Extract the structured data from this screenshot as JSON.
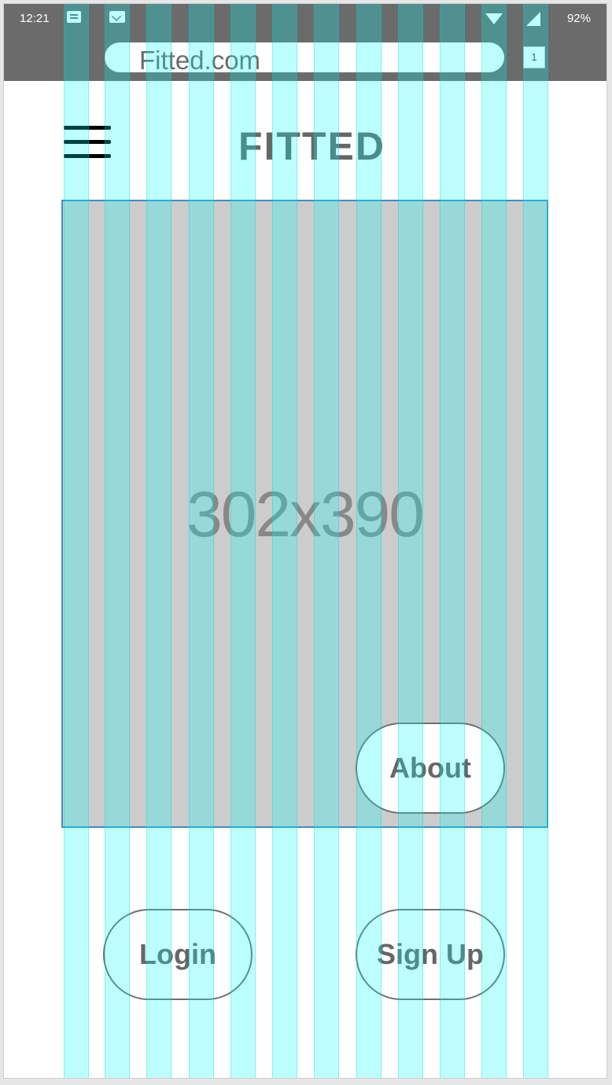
{
  "status_bar": {
    "time": "12:21",
    "battery": "92%",
    "icons": [
      "message-icon",
      "mail-icon",
      "wifi-icon",
      "signal-icon"
    ]
  },
  "browser": {
    "url": "Fitted.com",
    "tab_count": "1"
  },
  "header": {
    "logo": "FITTED",
    "menu_icon": "hamburger-menu-icon"
  },
  "hero": {
    "placeholder_label": "302x390"
  },
  "buttons": {
    "about": "About",
    "login": "Login",
    "signup": "Sign Up"
  },
  "colors": {
    "status_bar": "#6b6b6b",
    "grid_overlay": "#00ffff",
    "placeholder": "#cccccc",
    "placeholder_border": "#3f8fc2",
    "text": "#666666"
  }
}
